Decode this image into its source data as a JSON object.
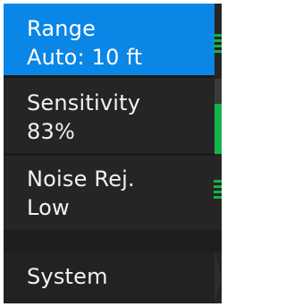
{
  "menu": {
    "range": {
      "title": "Range",
      "value": "Auto: 10 ft"
    },
    "sensitivity": {
      "title": "Sensitivity",
      "value": "83%",
      "level": 0.83
    },
    "noise_rejection": {
      "title": "Noise Rej.",
      "value": "Low"
    },
    "system": {
      "title": "System"
    }
  },
  "colors": {
    "selected": "#0a86e6",
    "indicator": "#16b24a",
    "background": "#252525"
  },
  "icons": {
    "range": "level-bars-icon",
    "sensitivity": "level-gauge-icon",
    "noise_rejection": "level-bars-icon",
    "system": "chevron-right-icon"
  }
}
